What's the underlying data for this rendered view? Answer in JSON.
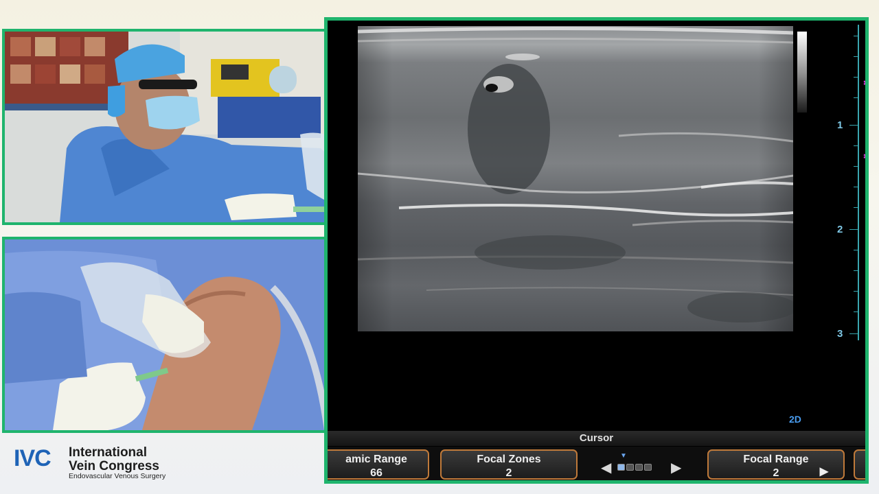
{
  "logo": {
    "mark": "IVC",
    "title_line1": "International",
    "title_line2": "Vein Congress",
    "subtitle": "Endovascular Venous Surgery"
  },
  "ultrasound": {
    "depth_labels": [
      "1",
      "2",
      "3"
    ],
    "mode": "2D",
    "cursor_label": "Cursor",
    "controls": [
      {
        "label": "amic Range",
        "value": "66"
      },
      {
        "label": "Focal Zones",
        "value": "2"
      },
      {
        "label": "Focal Range",
        "value": "2"
      }
    ],
    "page_dots": 4,
    "active_dot": 1
  },
  "colors": {
    "frame_green": "#1fb46d",
    "button_border": "#c07a3a",
    "depth_scale": "#3aa7b0",
    "focus_marker": "#d83ad8",
    "mode_text": "#4a9df0"
  },
  "icons": {
    "prev": "triangle-left",
    "next": "triangle-right",
    "focus": "asterisk"
  }
}
